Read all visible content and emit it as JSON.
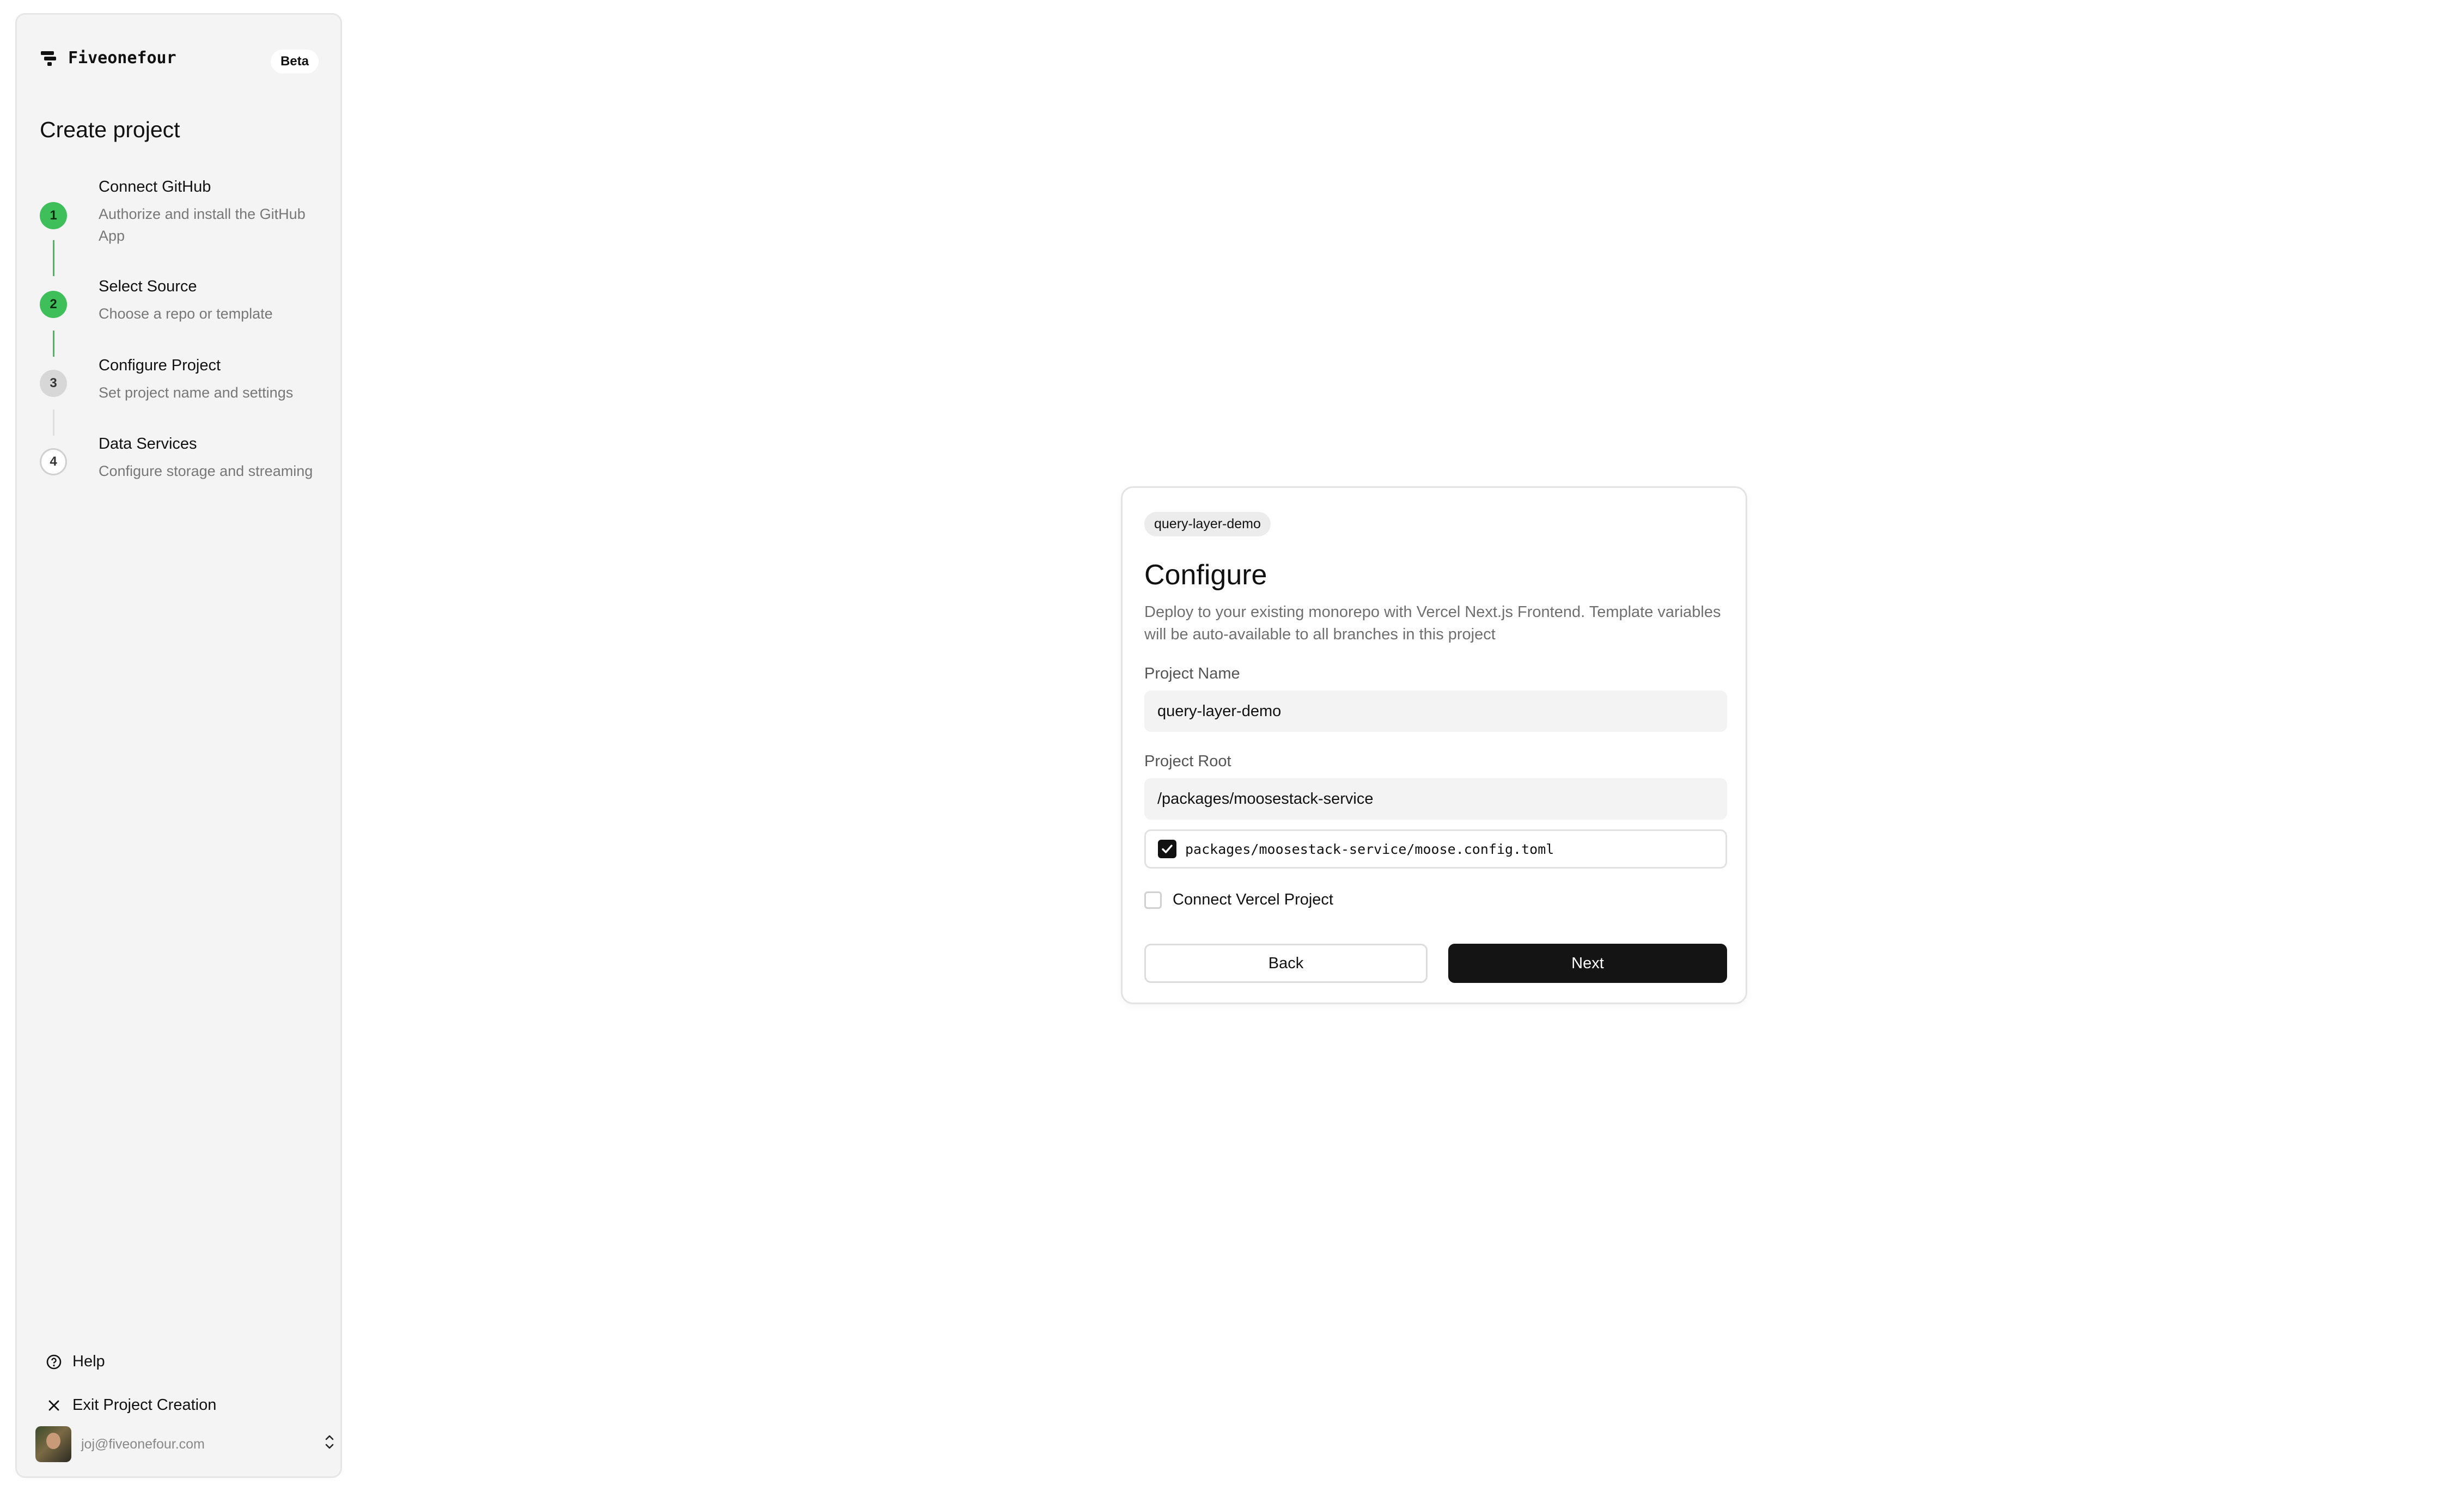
{
  "sidebar": {
    "brand_name": "Fiveonefour",
    "badge": "Beta",
    "title": "Create project",
    "steps": [
      {
        "number": "1",
        "title": "Connect GitHub",
        "description": "Authorize and install the GitHub App",
        "status": "complete"
      },
      {
        "number": "2",
        "title": "Select Source",
        "description": "Choose a repo or template",
        "status": "complete"
      },
      {
        "number": "3",
        "title": "Configure Project",
        "description": "Set project name and settings",
        "status": "current"
      },
      {
        "number": "4",
        "title": "Data Services",
        "description": "Configure storage and streaming",
        "status": "upcoming"
      }
    ],
    "help_label": "Help",
    "exit_label": "Exit Project Creation",
    "user_email": "joj@fiveonefour.com"
  },
  "card": {
    "chip": "query-layer-demo",
    "title": "Configure",
    "description": "Deploy to your existing monorepo with Vercel Next.js Frontend. Template variables will be auto-available to all branches in this project",
    "project_name_label": "Project Name",
    "project_name_value": "query-layer-demo",
    "project_root_label": "Project Root",
    "project_root_value": "/packages/moosestack-service",
    "config_file": "packages/moosestack-service/moose.config.toml",
    "config_file_checked": true,
    "vercel_label": "Connect Vercel Project",
    "vercel_checked": false,
    "back_label": "Back",
    "next_label": "Next"
  },
  "colors": {
    "step_complete": "#3fbf5a",
    "primary_button": "#141414",
    "sidebar_bg": "#f4f4f4"
  },
  "icons": {
    "brand": "fiveonefour-logo-icon",
    "help": "help-circle-icon",
    "exit": "close-icon",
    "user_menu": "chevron-up-down-icon",
    "checked": "checkmark-icon"
  }
}
